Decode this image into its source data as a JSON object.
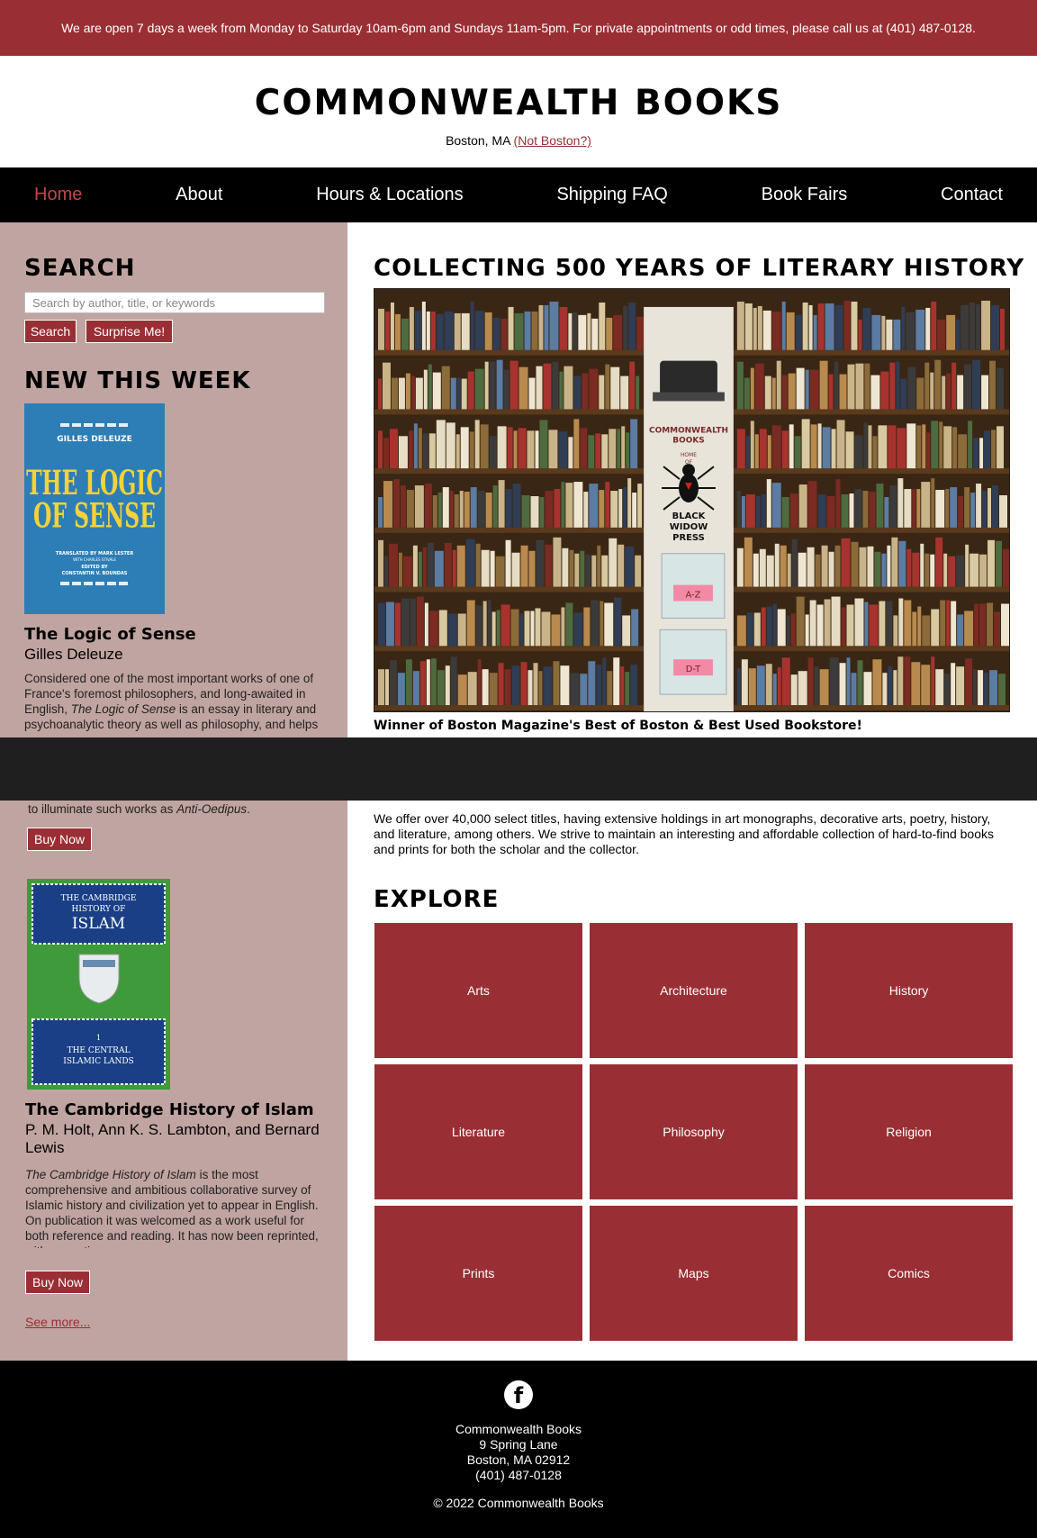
{
  "topbar": {
    "text": "We are open 7 days a week from Monday to Saturday 10am-6pm and Sundays 11am-5pm. For private appointments or odd times, please call us at (401) 487-0128."
  },
  "header": {
    "title": "COMMONWEALTH BOOKS",
    "location": "Boston, MA",
    "location_link": "(Not Boston?)"
  },
  "nav": [
    "Home",
    "About",
    "Hours & Locations",
    "Shipping FAQ",
    "Book Fairs",
    "Contact"
  ],
  "sidebar": {
    "search_heading": "SEARCH",
    "search_placeholder": "Search by author, title, or keywords",
    "search_button": "Search",
    "surprise_button": "Surprise Me!",
    "new_heading": "NEW THIS WEEK",
    "books": [
      {
        "cover_author": "GILLES DELEUZE",
        "cover_title_1": "THE LOGIC",
        "cover_title_2": "OF SENSE",
        "cover_credits_1": "TRANSLATED BY MARK LESTER",
        "cover_credits_2": "WITH CHARLES STIVALE",
        "cover_credits_3": "EDITED BY",
        "cover_credits_4": "CONSTANTIN V. BOUNDAS",
        "title": "The Logic of Sense",
        "author": "Gilles Deleuze",
        "desc_1": "Considered one of the most important works of one of France's foremost philosophers, and long-awaited in English, ",
        "desc_em": "The Logic of Sense",
        "desc_2": " is an essay in literary and psychoanalytic theory as well as philosophy, and helps",
        "desc_3": "to illuminate such works as ",
        "desc_3_em": "Anti-Oedipus",
        "desc_3_end": ".",
        "buy": "Buy Now"
      },
      {
        "cover_top_1": "THE CAMBRIDGE",
        "cover_top_2": "HISTORY OF",
        "cover_top_3": "ISLAM",
        "cover_bottom_1": "1",
        "cover_bottom_2": "THE CENTRAL",
        "cover_bottom_3": "ISLAMIC LANDS",
        "title": "The Cambridge History of Islam",
        "author": "P. M. Holt, Ann K. S. Lambton, and Bernard Lewis",
        "desc_em": "The Cambridge History of Islam",
        "desc": " is the most comprehensive and ambitious collaborative survey of Islamic history and civilization yet to appear in English. On publication it was welcomed as a work useful for both reference and reading. It has now been reprinted, with corrections.",
        "buy": "Buy Now"
      }
    ],
    "see_more": "See more..."
  },
  "main": {
    "heading": "COLLECTING 500 YEARS OF LITERARY HISTORY",
    "hero": {
      "sign_1": "COMMONWEALTH",
      "sign_2": "BOOKS",
      "sign_3": "HOME",
      "sign_4": "OF",
      "sign_5": "BLACK",
      "sign_6": "WIDOW",
      "sign_7": "PRESS",
      "bin_1": "A-Z",
      "bin_2": "D-T"
    },
    "caption": "Winner of Boston Magazine's Best of Boston & Best Used Bookstore!",
    "intro": "We offer over 40,000 select titles, having extensive holdings in art monographs, decorative arts, poetry, history, and literature, among others. We strive to maintain an interesting and affordable collection of hard-to-find books and prints for both the scholar and the collector.",
    "explore_heading": "EXPLORE",
    "categories": [
      "Arts",
      "Architecture",
      "History",
      "Literature",
      "Philosophy",
      "Religion",
      "Prints",
      "Maps",
      "Comics"
    ]
  },
  "footer": {
    "icon": "facebook-icon",
    "fb_glyph": "f",
    "address": [
      "Commonwealth Books",
      "9 Spring Lane",
      "Boston, MA 02912",
      "(401) 487-0128"
    ],
    "copyright": "© 2022 Commonwealth Books"
  },
  "colors": {
    "brand": "#992f34",
    "sidebar": "#c0a4a1",
    "nav": "#000000"
  }
}
